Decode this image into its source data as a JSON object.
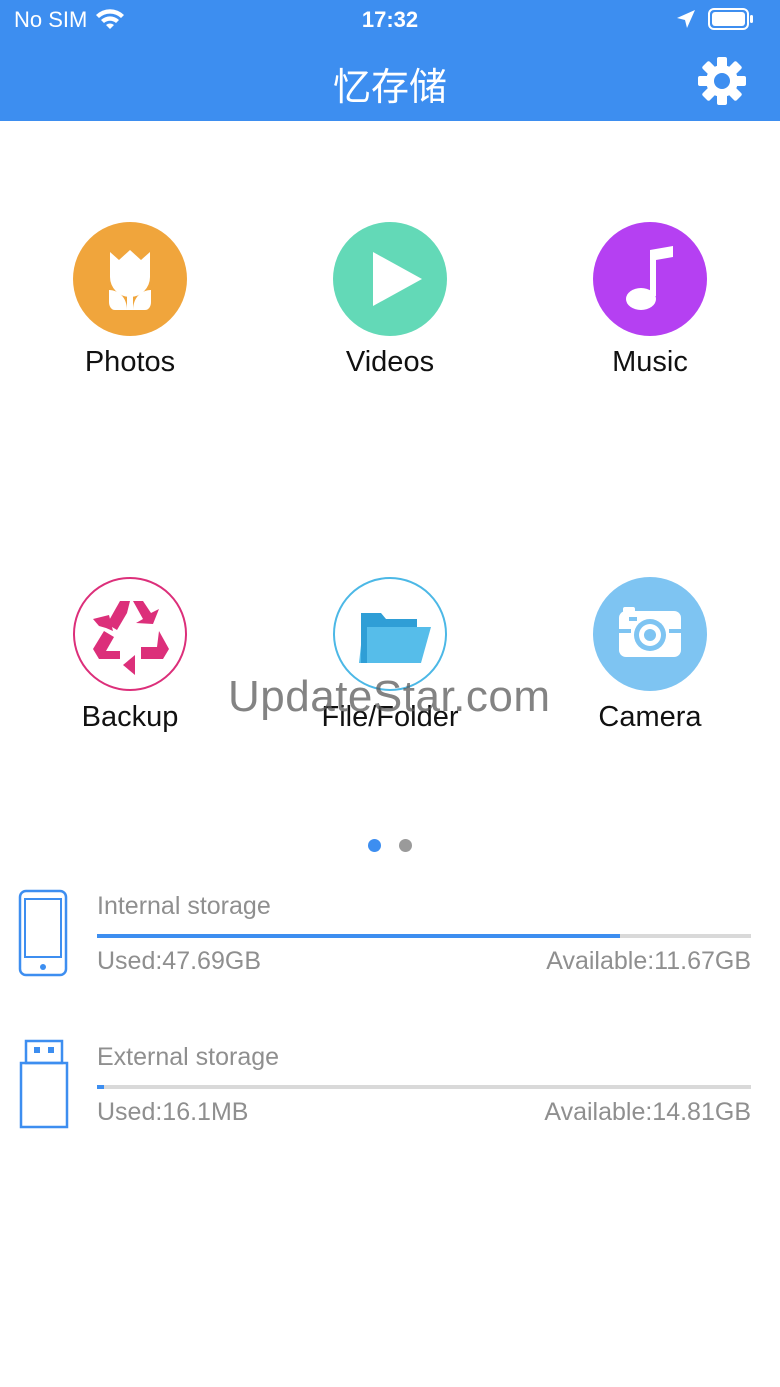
{
  "status_bar": {
    "carrier": "No SIM",
    "time": "17:32"
  },
  "header": {
    "title": "忆存储"
  },
  "tiles": [
    {
      "label": "Photos",
      "color": "#f0a53c",
      "icon": "tulip-icon"
    },
    {
      "label": "Videos",
      "color": "#63d9b7",
      "icon": "play-icon"
    },
    {
      "label": "Music",
      "color": "#b540f2",
      "icon": "music-note-icon"
    },
    {
      "label": "Backup",
      "color": "#dc2f7a",
      "icon": "recycle-icon"
    },
    {
      "label": "File/Folder",
      "color": "#4cb8e6",
      "icon": "folder-icon"
    },
    {
      "label": "Camera",
      "color": "#7ec4f2",
      "icon": "camera-icon"
    }
  ],
  "watermark": "UpdateStar.com",
  "pager": {
    "pages": 2,
    "active": 0
  },
  "storage": {
    "internal": {
      "title": "Internal storage",
      "used": "Used:47.69GB",
      "available": "Available:11.67GB",
      "fill_fraction": 0.8
    },
    "external": {
      "title": "External storage",
      "used": "Used:16.1MB",
      "available": "Available:14.81GB",
      "fill_fraction": 0.01
    }
  },
  "colors": {
    "accent": "#3d8ef0"
  }
}
